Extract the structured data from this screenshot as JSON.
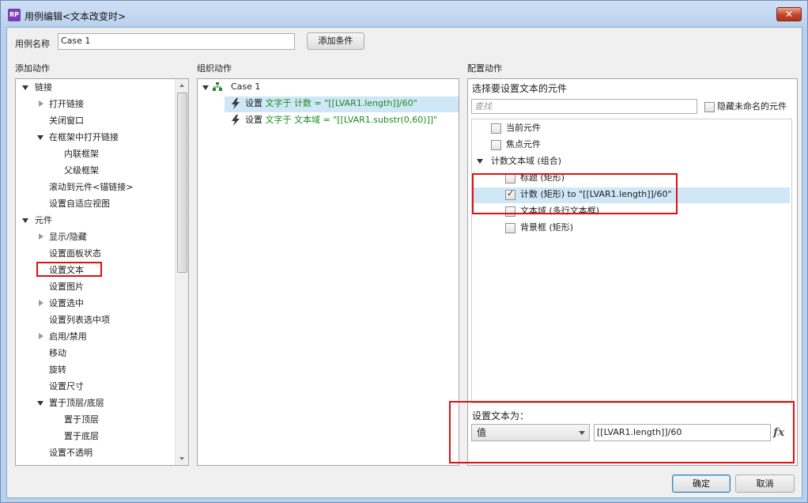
{
  "window": {
    "title": "用例编辑<文本改变时>",
    "app_icon": "RP",
    "close_glyph": "✕"
  },
  "case_name": {
    "label": "用例名称",
    "value": "Case 1",
    "add_condition": "添加条件"
  },
  "add_actions": {
    "header": "添加动作",
    "items": [
      {
        "label": "链接"
      },
      {
        "label": "打开链接"
      },
      {
        "label": "关闭窗口"
      },
      {
        "label": "在框架中打开链接"
      },
      {
        "label": "内联框架"
      },
      {
        "label": "父级框架"
      },
      {
        "label": "滚动到元件<锚链接>"
      },
      {
        "label": "设置自适应视图"
      },
      {
        "label": "元件"
      },
      {
        "label": "显示/隐藏"
      },
      {
        "label": "设置面板状态"
      },
      {
        "label": "设置文本"
      },
      {
        "label": "设置图片"
      },
      {
        "label": "设置选中"
      },
      {
        "label": "设置列表选中项"
      },
      {
        "label": "启用/禁用"
      },
      {
        "label": "移动"
      },
      {
        "label": "旋转"
      },
      {
        "label": "设置尺寸"
      },
      {
        "label": "置于顶层/底层"
      },
      {
        "label": "置于顶层"
      },
      {
        "label": "置于底层"
      },
      {
        "label": "设置不透明"
      }
    ]
  },
  "organize_actions": {
    "header": "组织动作",
    "case_label": "Case 1",
    "actions": [
      {
        "prefix": "设置",
        "detail": "文字于 计数 = \"[[LVAR1.length]]/60\""
      },
      {
        "prefix": "设置",
        "detail": "文字于 文本域 = \"[[LVAR1.substr(0,60)]]\""
      }
    ]
  },
  "configure_actions": {
    "header": "配置动作",
    "subheader": "选择要设置文本的元件",
    "search_placeholder": "查找",
    "hide_unnamed": "隐藏未命名的元件",
    "items": [
      {
        "label": "当前元件",
        "checked": false
      },
      {
        "label": "焦点元件",
        "checked": false
      },
      {
        "label": "计数文本域 (组合)"
      },
      {
        "label": "标题 (矩形)",
        "checked": false
      },
      {
        "label": "计数 (矩形) to \"[[LVAR1.length]]/60\"",
        "checked": true
      },
      {
        "label": "文本域 (多行文本框)",
        "checked": false
      },
      {
        "label": "背景框 (矩形)",
        "checked": false
      }
    ],
    "set_text_label": "设置文本为：",
    "value_type": "值",
    "value_text": "[[LVAR1.length]]/60",
    "fx_label": "fx"
  },
  "footer": {
    "ok": "确定",
    "cancel": "取消"
  },
  "colors": {
    "accent_highlight": "#cfe7f7",
    "annotation_red": "#e01010",
    "green_text": "#1c8a1c"
  }
}
